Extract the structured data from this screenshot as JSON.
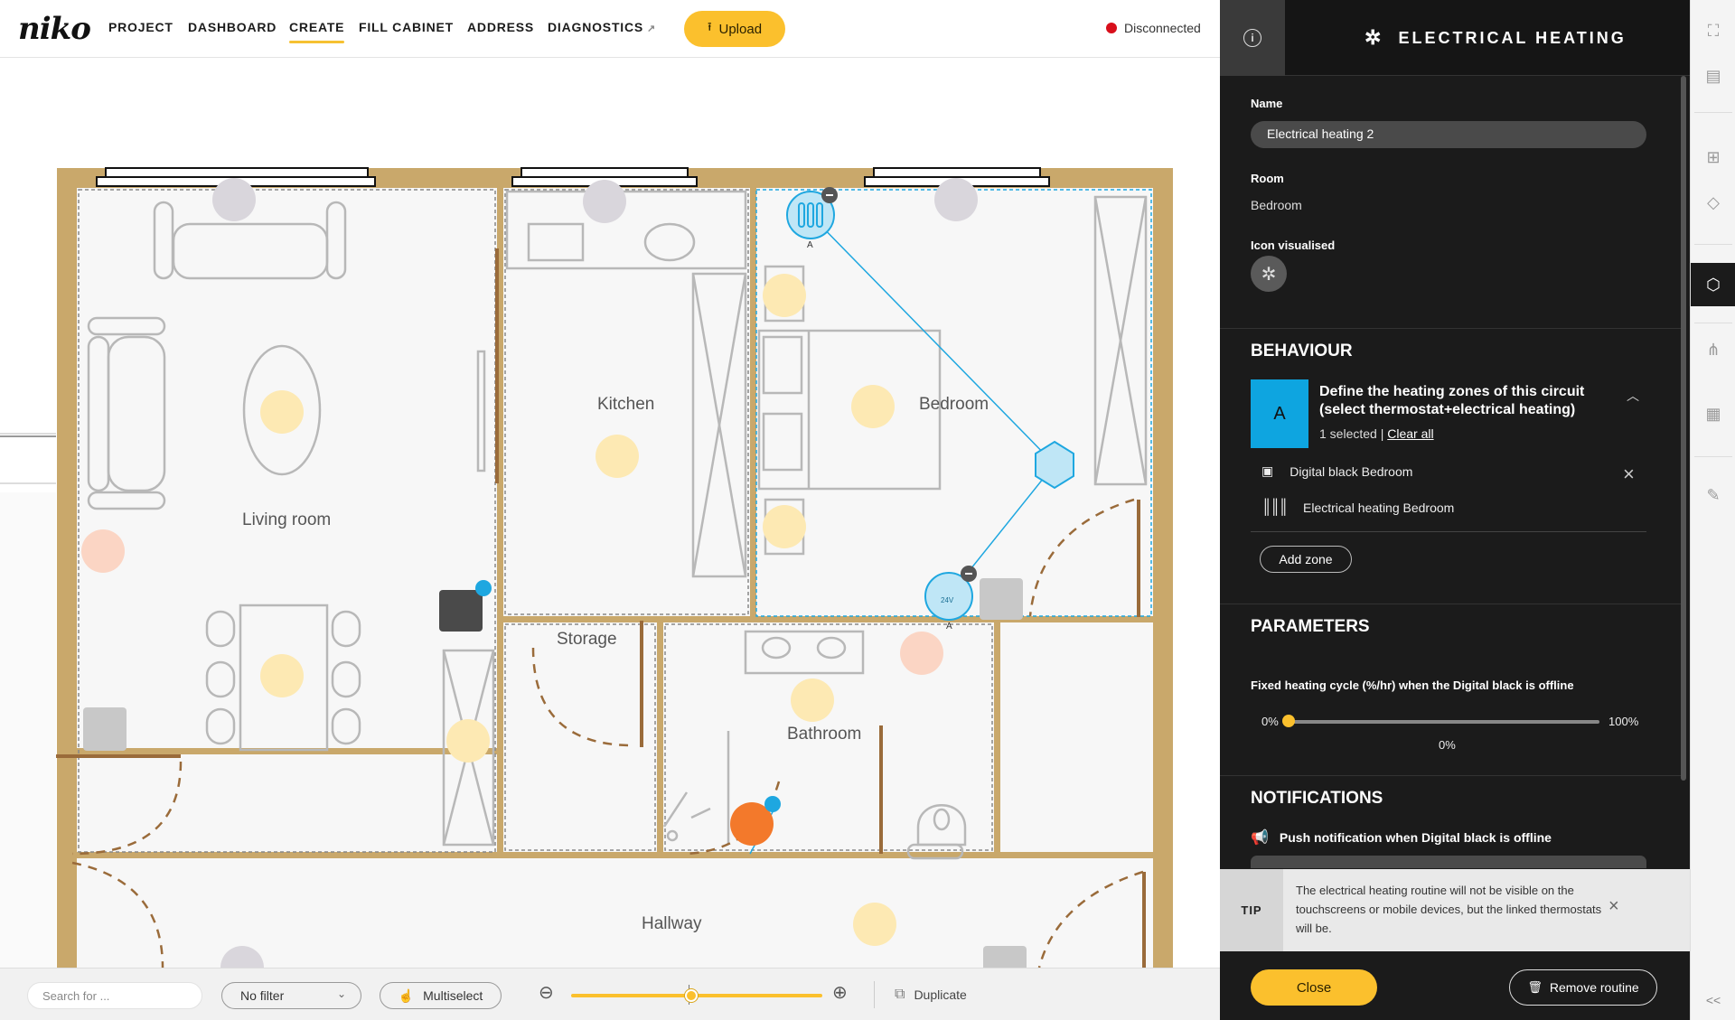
{
  "app": {
    "logo": "niko"
  },
  "nav": {
    "items": [
      "PROJECT",
      "DASHBOARD",
      "CREATE",
      "FILL CABINET",
      "ADDRESS",
      "DIAGNOSTICS"
    ],
    "active": "CREATE",
    "upload_label": "Upload",
    "status_label": "Disconnected",
    "status_color": "#d80f1b"
  },
  "floorplan": {
    "rooms": [
      "Living room",
      "Kitchen",
      "Bedroom",
      "Storage",
      "Bathroom",
      "Hallway"
    ],
    "device_labels": [
      "A",
      "A",
      "24V"
    ],
    "link_color": "#1ea7e0",
    "wall_color": "#c9a86b"
  },
  "toolbar": {
    "search_placeholder": "Search for ...",
    "filter_value": "No filter",
    "multiselect_label": "Multiselect",
    "zoom_level": 0.48,
    "duplicate_label": "Duplicate"
  },
  "panel": {
    "title": "ELECTRICAL HEATING",
    "name_label": "Name",
    "name_value": "Electrical heating 2",
    "room_label": "Room",
    "room_value": "Bedroom",
    "icon_label": "Icon visualised",
    "behaviour": {
      "heading": "BEHAVIOUR",
      "zone_letter": "A",
      "zone_title": "Define the heating zones of this circuit (select thermostat+electrical heating)",
      "selected_count": "1 selected |",
      "clear_all": "Clear all",
      "zone_items": [
        "Digital black Bedroom",
        "Electrical heating Bedroom"
      ],
      "add_zone": "Add zone"
    },
    "parameters": {
      "heading": "PARAMETERS",
      "cycle_label": "Fixed heating cycle (%/hr) when the Digital black is offline",
      "min": "0%",
      "max": "100%",
      "value": "0%",
      "value_fraction": 0
    },
    "notifications": {
      "heading": "NOTIFICATIONS",
      "push_label": "Push notification when Digital black is offline"
    },
    "tip": {
      "label": "TIP",
      "text": "The electrical heating routine will not be visible on the touchscreens or mobile devices, but the linked thermostats will be."
    },
    "close_label": "Close",
    "remove_label": "Remove routine"
  },
  "rail": {
    "icons": [
      "fullscreen-icon",
      "map-icon",
      "add-device-icon",
      "shapes-icon",
      "routine-icon",
      "connections-icon",
      "calendar-icon",
      "tools-icon"
    ],
    "active": "routine-icon",
    "collapse": "<<"
  },
  "colors": {
    "accent": "#fbc02d",
    "panel_bg": "#1b1b1b",
    "zone_blue": "#0ea5e0"
  }
}
